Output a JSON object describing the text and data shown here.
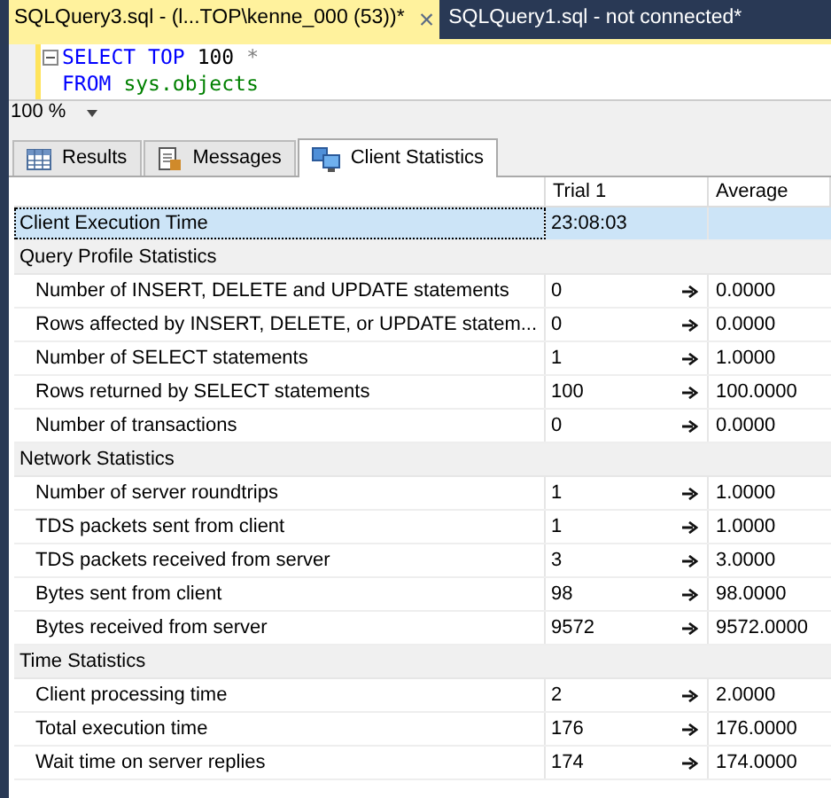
{
  "doc_tabs": [
    {
      "label": "SQLQuery3.sql - (l...TOP\\kenne_000 (53))*",
      "selected": true,
      "close": "×"
    },
    {
      "label": "SQLQuery1.sql - not connected*",
      "selected": false
    }
  ],
  "editor": {
    "lines": [
      {
        "collapsible": true,
        "tokens": [
          {
            "text": "SELECT",
            "kind": "keyword"
          },
          {
            "text": "TOP",
            "kind": "keyword"
          },
          {
            "text": "100",
            "kind": "number"
          },
          {
            "text": "*",
            "kind": "operator"
          }
        ]
      },
      {
        "collapsible": false,
        "tokens": [
          {
            "text": "FROM",
            "kind": "keyword"
          },
          {
            "text": "sys.objects",
            "kind": "object"
          }
        ]
      }
    ]
  },
  "zoom": {
    "value": "100 %"
  },
  "result_tabs": [
    {
      "label": "Results",
      "selected": false
    },
    {
      "label": "Messages",
      "selected": false
    },
    {
      "label": "Client Statistics",
      "selected": true
    }
  ],
  "table": {
    "columns": [
      "",
      "Trial  1",
      "Average"
    ],
    "rows": [
      {
        "kind": "stat",
        "label": "Client Execution Time",
        "trial": "23:08:03",
        "average": "",
        "selected": true
      },
      {
        "kind": "section",
        "label": "Query Profile Statistics"
      },
      {
        "kind": "stat",
        "label": "Number of INSERT, DELETE and UPDATE statements",
        "trial": "0",
        "average": "0.0000",
        "selected": false
      },
      {
        "kind": "stat",
        "label": "Rows affected by INSERT, DELETE, or UPDATE statem...",
        "trial": "0",
        "average": "0.0000",
        "selected": false
      },
      {
        "kind": "stat",
        "label": "Number of SELECT statements",
        "trial": "1",
        "average": "1.0000",
        "selected": false
      },
      {
        "kind": "stat",
        "label": "Rows returned by SELECT statements",
        "trial": "100",
        "average": "100.0000",
        "selected": false
      },
      {
        "kind": "stat",
        "label": "Number of transactions",
        "trial": "0",
        "average": "0.0000",
        "selected": false
      },
      {
        "kind": "section",
        "label": "Network Statistics"
      },
      {
        "kind": "stat",
        "label": "Number of server roundtrips",
        "trial": "1",
        "average": "1.0000",
        "selected": false
      },
      {
        "kind": "stat",
        "label": "TDS packets sent from client",
        "trial": "1",
        "average": "1.0000",
        "selected": false
      },
      {
        "kind": "stat",
        "label": "TDS packets received from server",
        "trial": "3",
        "average": "3.0000",
        "selected": false
      },
      {
        "kind": "stat",
        "label": "Bytes sent from client",
        "trial": "98",
        "average": "98.0000",
        "selected": false
      },
      {
        "kind": "stat",
        "label": "Bytes received from server",
        "trial": "9572",
        "average": "9572.0000",
        "selected": false
      },
      {
        "kind": "section",
        "label": "Time Statistics"
      },
      {
        "kind": "stat",
        "label": "Client processing time",
        "trial": "2",
        "average": "2.0000",
        "selected": false
      },
      {
        "kind": "stat",
        "label": "Total execution time",
        "trial": "176",
        "average": "176.0000",
        "selected": false
      },
      {
        "kind": "stat",
        "label": "Wait time on server replies",
        "trial": "174",
        "average": "174.0000",
        "selected": false
      }
    ]
  }
}
